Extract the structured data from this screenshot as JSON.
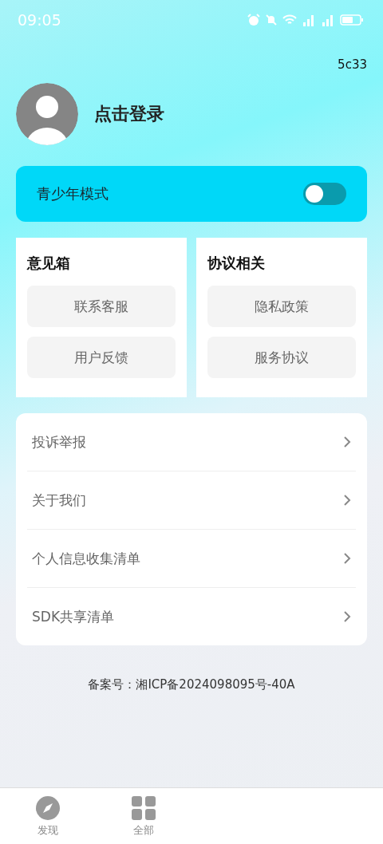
{
  "status_bar": {
    "time": "09:05"
  },
  "version": "5c33",
  "profile": {
    "login_label": "点击登录"
  },
  "teen_mode": {
    "label": "青少年模式",
    "on": false
  },
  "cards": [
    {
      "title": "意见箱",
      "buttons": [
        "联系客服",
        "用户反馈"
      ]
    },
    {
      "title": "协议相关",
      "buttons": [
        "隐私政策",
        "服务协议"
      ]
    }
  ],
  "menu": [
    {
      "label": "投诉举报"
    },
    {
      "label": "关于我们"
    },
    {
      "label": "个人信息收集清单"
    },
    {
      "label": "SDK共享清单"
    }
  ],
  "record_number": "备案号：湘ICP备2024098095号-40A",
  "bottom_nav": [
    {
      "kind": "compass",
      "label": "发现",
      "selected": false
    },
    {
      "kind": "grid",
      "label": "全部",
      "selected": false
    }
  ]
}
